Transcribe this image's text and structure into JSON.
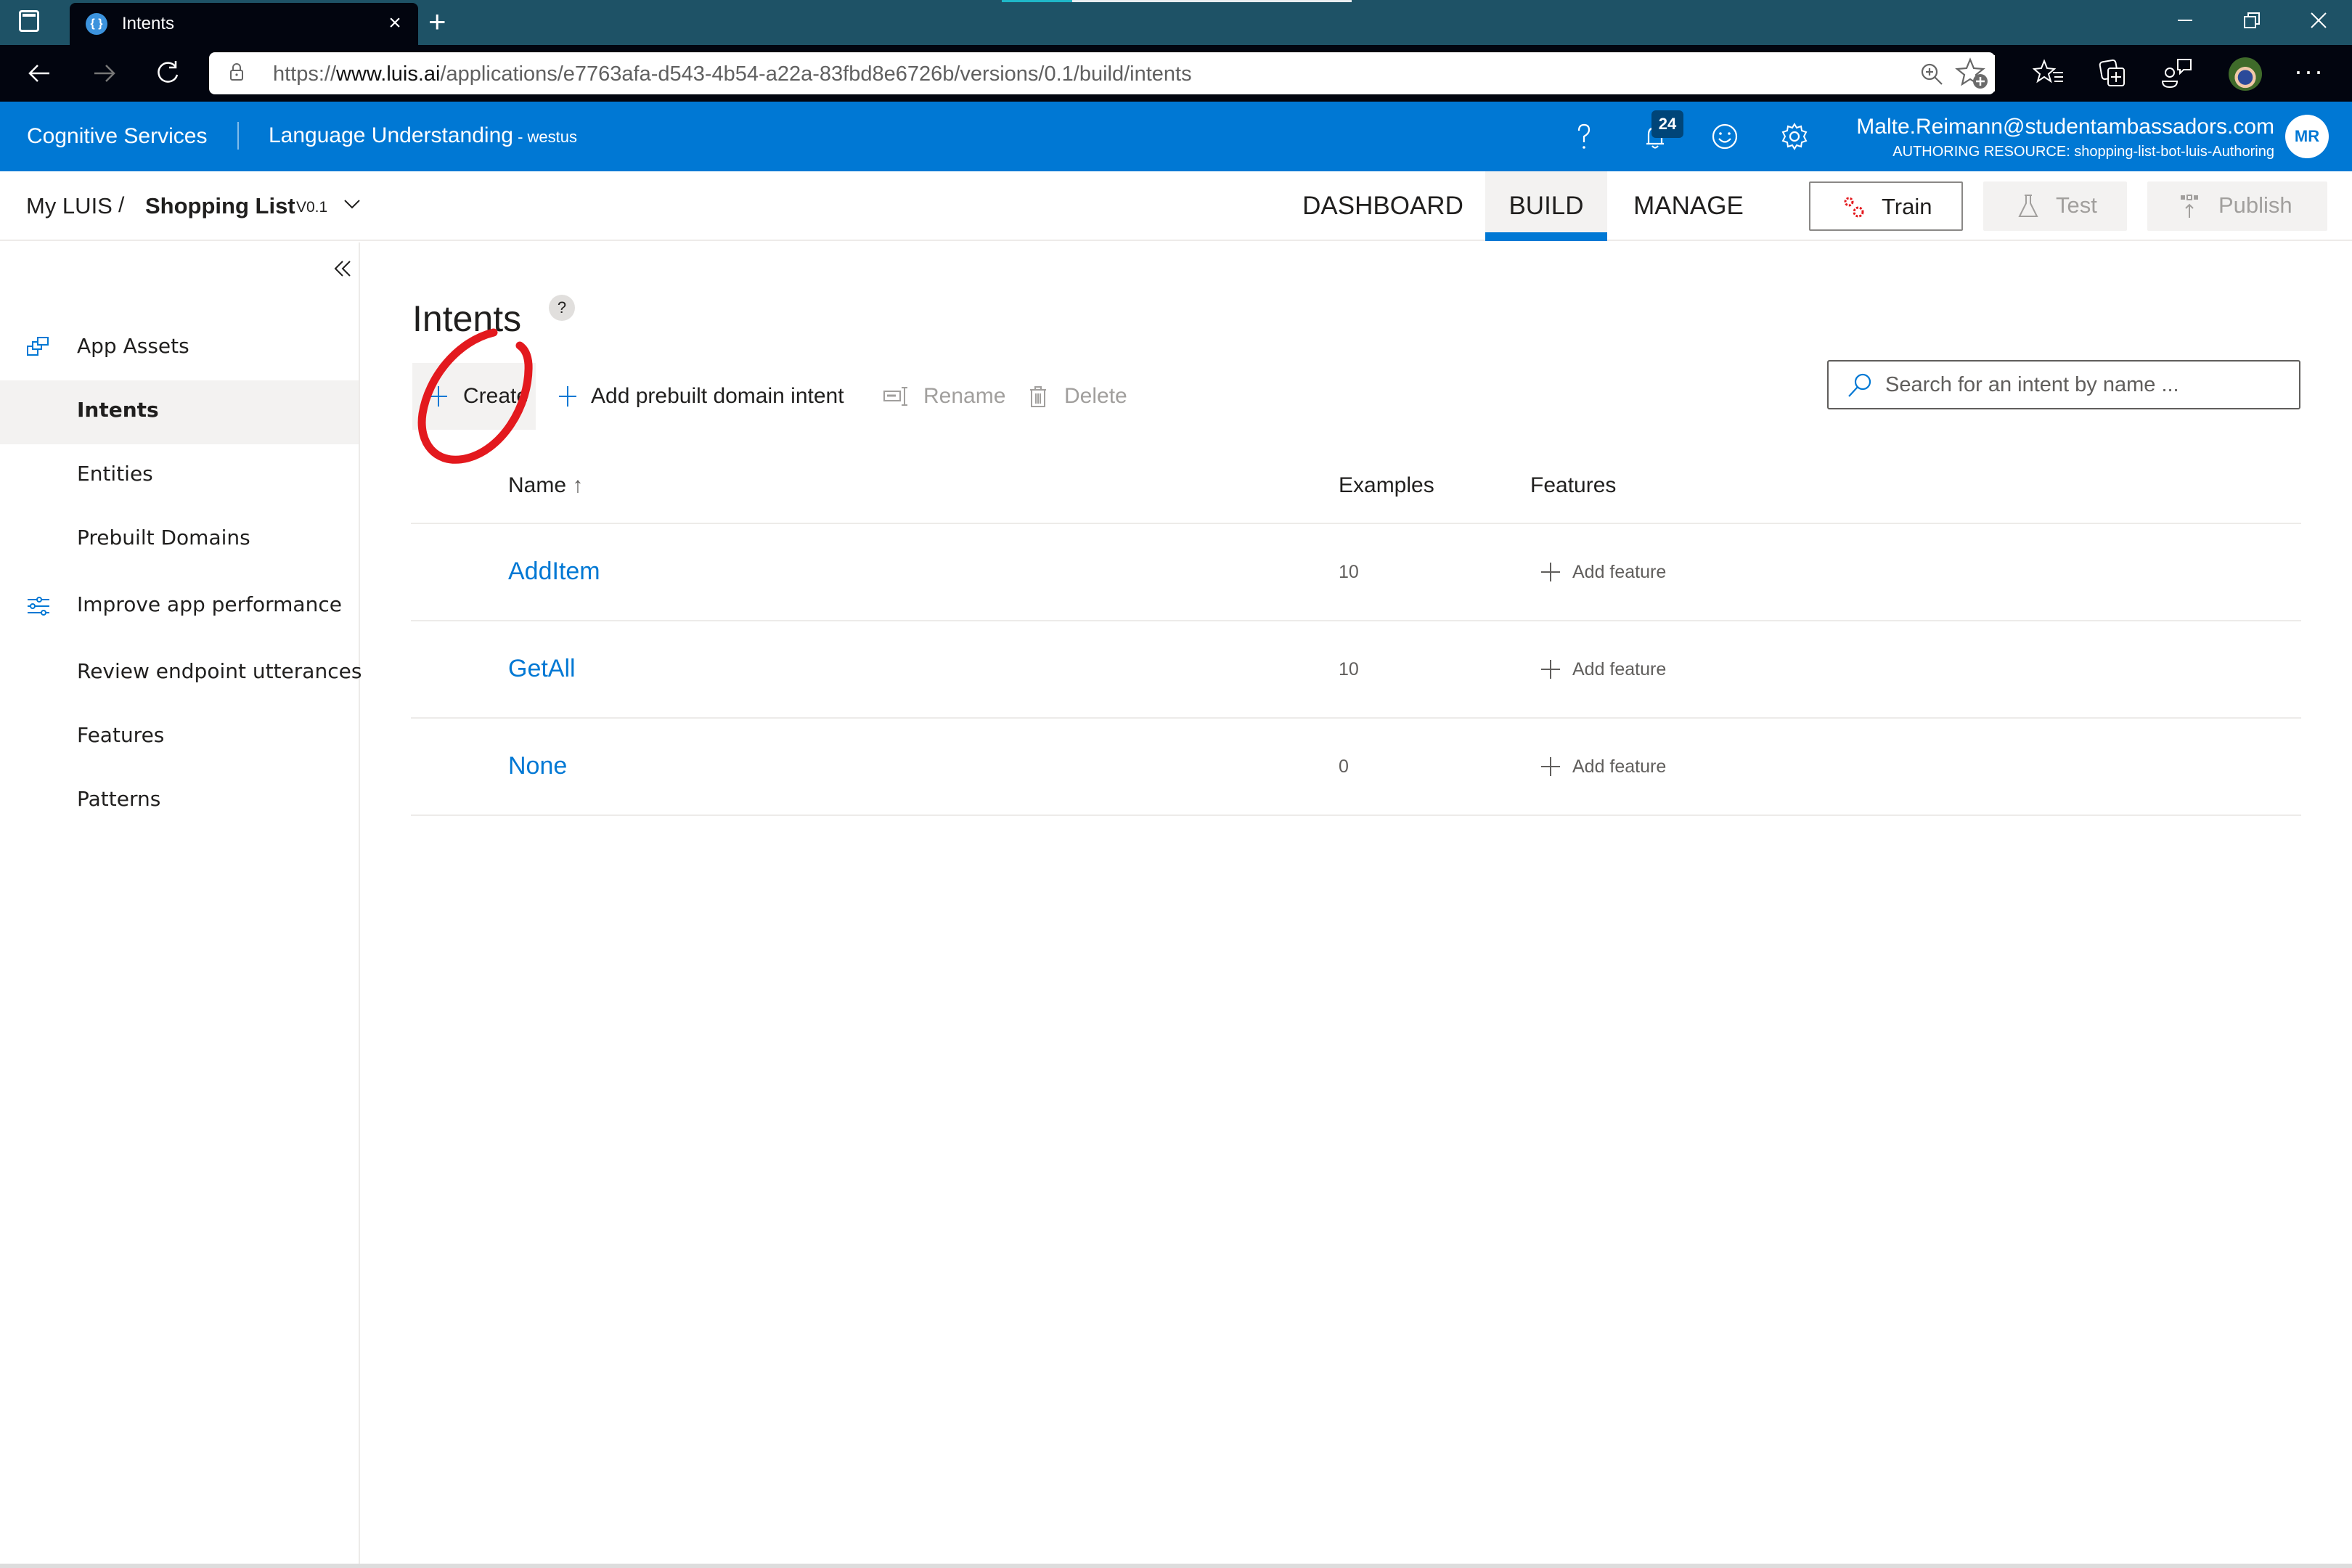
{
  "browser": {
    "tab_title": "Intents",
    "favicon_glyph": "{ }",
    "new_tab_label": "+",
    "close_tab_glyph": "×",
    "url_prefix": "https://",
    "url_host": "www.luis.ai",
    "url_path": "/applications/e7763afa-d543-4b54-a22a-83fbd8e6726b/versions/0.1/build/intents",
    "window_controls": {
      "minimize": "—",
      "restore": "❐",
      "close": "✕"
    },
    "nav": {
      "back": "←",
      "forward": "→",
      "refresh": "↻"
    },
    "more_glyph": "···"
  },
  "header": {
    "brand": "Cognitive Services",
    "product": "Language Understanding",
    "region": " - westus",
    "notification_count": "24",
    "user_email": "Malte.Reimann@studentambassadors.com",
    "authoring_resource": "AUTHORING RESOURCE:  shopping-list-bot-luis-Authoring",
    "user_initials": "MR",
    "accent_color": "#0078d4"
  },
  "subheader": {
    "breadcrumb_root": "My LUIS",
    "breadcrumb_sep": "/",
    "app_name": "Shopping List",
    "version": "V0.1",
    "tabs": [
      {
        "label": "DASHBOARD",
        "active": false
      },
      {
        "label": "BUILD",
        "active": true
      },
      {
        "label": "MANAGE",
        "active": false
      }
    ],
    "train_label": "Train",
    "test_label": "Test",
    "publish_label": "Publish"
  },
  "sidebar": {
    "items": [
      {
        "label": "App Assets",
        "icon": "app-assets-icon",
        "selected": false
      },
      {
        "label": "Intents",
        "icon": "",
        "selected": true
      },
      {
        "label": "Entities",
        "icon": "",
        "selected": false
      },
      {
        "label": "Prebuilt Domains",
        "icon": "",
        "selected": false
      },
      {
        "label": "Improve app performance",
        "icon": "sliders-icon",
        "selected": false
      },
      {
        "label": "Review endpoint utterances",
        "icon": "",
        "selected": false
      },
      {
        "label": "Features",
        "icon": "",
        "selected": false
      },
      {
        "label": "Patterns",
        "icon": "",
        "selected": false
      }
    ]
  },
  "main": {
    "title": "Intents",
    "help_glyph": "?",
    "toolbar": {
      "create_label": "Create",
      "add_prebuilt_label": "Add prebuilt domain intent",
      "rename_label": "Rename",
      "delete_label": "Delete"
    },
    "search": {
      "placeholder": "Search for an intent by name ...",
      "value": ""
    },
    "table": {
      "columns": {
        "name": "Name",
        "sort_glyph": "↑",
        "examples": "Examples",
        "features": "Features"
      },
      "rows": [
        {
          "name": "AddItem",
          "examples": "10",
          "feature_action": "Add feature"
        },
        {
          "name": "GetAll",
          "examples": "10",
          "feature_action": "Add feature"
        },
        {
          "name": "None",
          "examples": "0",
          "feature_action": "Add feature"
        }
      ]
    },
    "annotation": {
      "type": "hand-drawn circle",
      "color": "#e3191e",
      "target": "Create"
    }
  }
}
